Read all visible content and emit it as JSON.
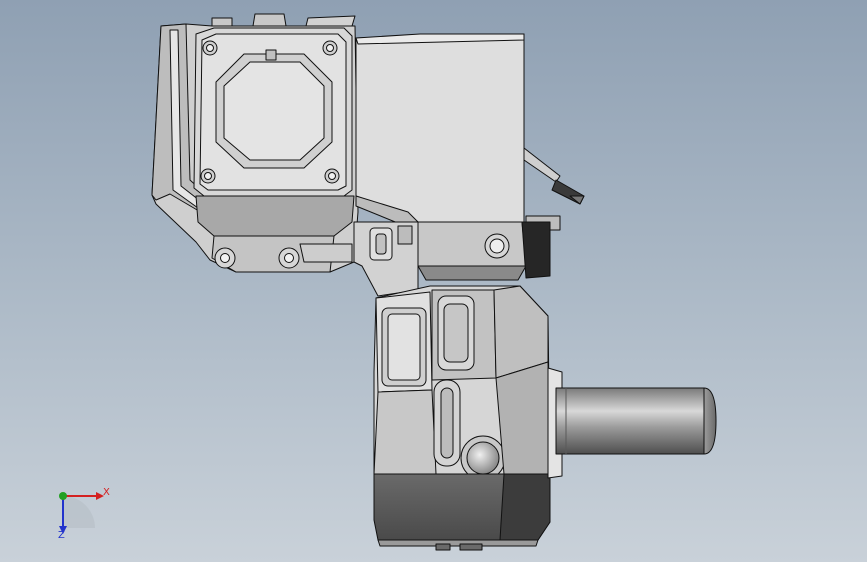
{
  "triad": {
    "x_label": "X",
    "z_label": "Z"
  },
  "colors": {
    "background_top": "#8fa0b3",
    "background_bottom": "#c9d1d9",
    "housing_light": "#dcdcdc",
    "housing_mid": "#c4c4c4",
    "housing_dark": "#5f5f5f",
    "housing_black": "#262626",
    "outline": "#111111",
    "axis_x": "#d42020",
    "axis_y": "#22a022",
    "axis_z": "#2233cc"
  }
}
